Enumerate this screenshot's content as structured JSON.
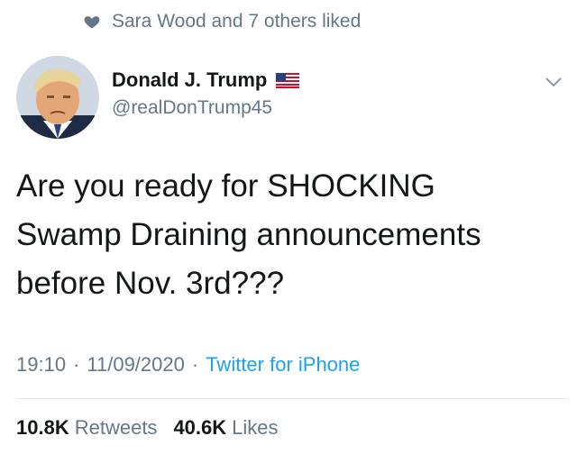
{
  "social_context": {
    "icon": "heart-icon",
    "text": "Sara Wood and 7 others liked"
  },
  "author": {
    "display_name": "Donald J. Trump",
    "handle": "@realDonTrump45",
    "flag_icon": "us-flag-icon"
  },
  "tweet": {
    "line1": "Are you ready for SHOCKING",
    "line2": "Swamp Draining announcements",
    "line3": "before Nov. 3rd???"
  },
  "meta": {
    "time": "19:10",
    "date": "11/09/2020",
    "separator": "·",
    "source": "Twitter for iPhone"
  },
  "stats": {
    "retweets_count": "10.8K",
    "retweets_label": "Retweets",
    "likes_count": "40.6K",
    "likes_label": "Likes"
  },
  "colors": {
    "muted": "#657786",
    "link": "#1da1f2",
    "text": "#14171a"
  }
}
